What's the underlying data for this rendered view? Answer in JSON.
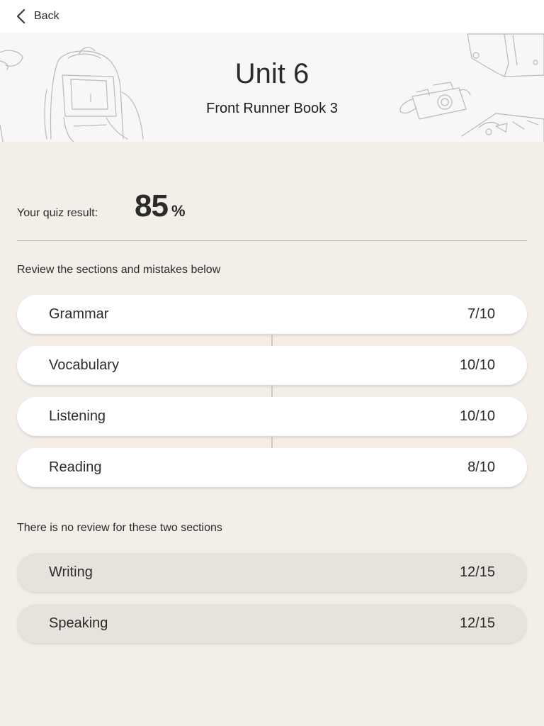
{
  "nav": {
    "back_label": "Back"
  },
  "header": {
    "title": "Unit 6",
    "subtitle": "Front Runner Book 3"
  },
  "result": {
    "label": "Your quiz result:",
    "value": "85",
    "unit": "%"
  },
  "review": {
    "hint": "Review the sections and mistakes below",
    "sections": [
      {
        "name": "Grammar",
        "score": "7/10"
      },
      {
        "name": "Vocabulary",
        "score": "10/10"
      },
      {
        "name": "Listening",
        "score": "10/10"
      },
      {
        "name": "Reading",
        "score": "8/10"
      }
    ]
  },
  "no_review": {
    "hint": "There is no review for these two sections",
    "sections": [
      {
        "name": "Writing",
        "score": "12/15"
      },
      {
        "name": "Speaking",
        "score": "12/15"
      }
    ]
  },
  "colors": {
    "page_background": "#f3eee8",
    "card_active": "#ffffff",
    "card_inactive": "#e7e2dc",
    "text": "#2b2b2b"
  }
}
